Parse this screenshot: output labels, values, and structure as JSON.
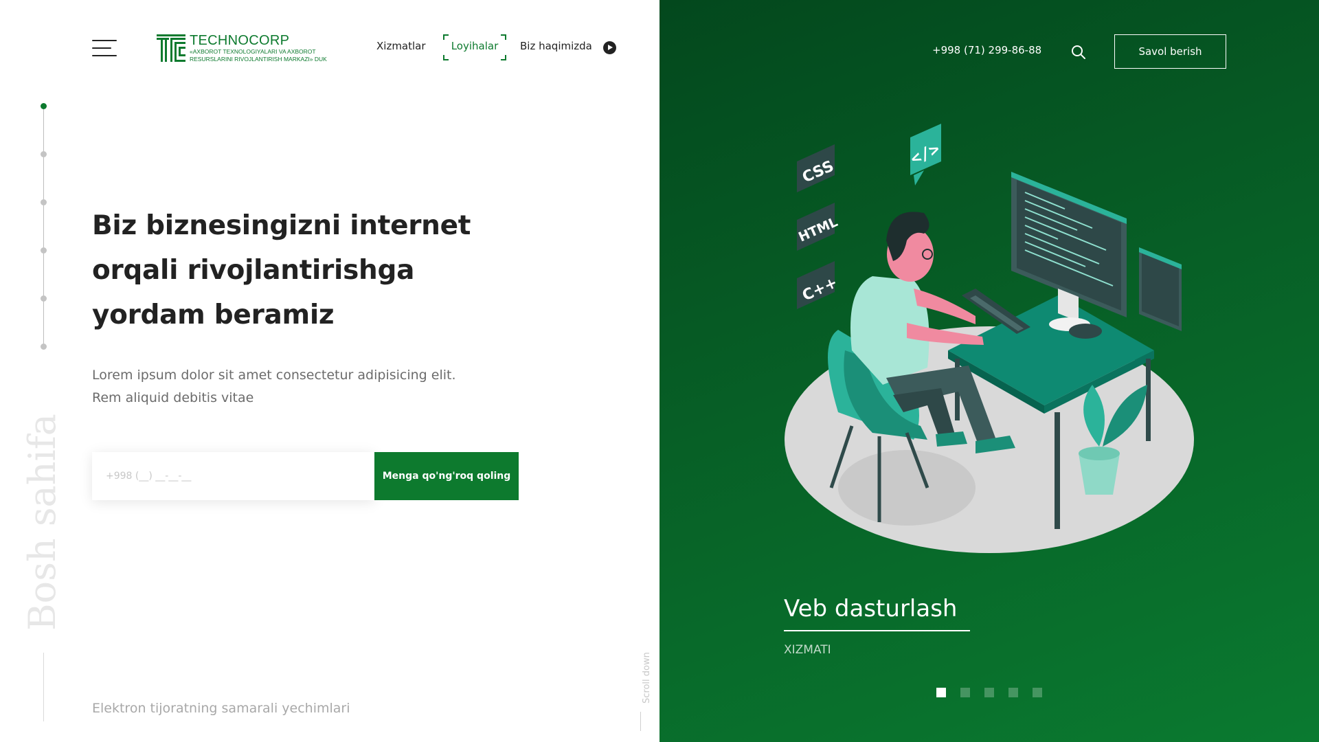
{
  "header": {
    "logo": {
      "name": "TECHNOCORP",
      "subtitle_line1": "«AXBOROT TEXNOLOGIYALARI VA AXBOROT",
      "subtitle_line2": "RESURSLARINI RIVOJLANTIRISH MARKAZI» DUK"
    },
    "nav": [
      {
        "label": "Xizmatlar"
      },
      {
        "label": "Loyihalar",
        "active": true
      },
      {
        "label": "Biz haqimizda"
      }
    ],
    "phone": "+998 (71) 299-86-88",
    "ask_button": "Savol berish"
  },
  "side": {
    "section_label": "Bosh sahifa",
    "steps_total": 6,
    "active_step": 1,
    "scroll_label": "Scroll down"
  },
  "hero": {
    "title": "Biz biznesingizni internet orqali rivojlantirishga yordam beramiz",
    "subtitle_line1": "Lorem ipsum dolor sit amet consectetur adipisicing elit.",
    "subtitle_line2": "Rem aliquid debitis vitae",
    "phone_placeholder": "+998 (__) __-__-__",
    "call_button": "Menga qo'ng'roq qoling",
    "tagline": "Elektron tijoratning samarali yechimlari"
  },
  "slider": {
    "title": "Veb dasturlash",
    "subtitle": "XIZMATI",
    "total": 5,
    "active": 1,
    "badges": [
      "CSS",
      "HTML",
      "C++",
      "</>"
    ]
  },
  "colors": {
    "brand_green": "#0d7a2e",
    "panel_dark": "#03481d",
    "teal": "#2bb39a",
    "pink": "#f08aa0"
  },
  "icons": [
    "menu-icon",
    "play-circle-icon",
    "search-icon"
  ]
}
